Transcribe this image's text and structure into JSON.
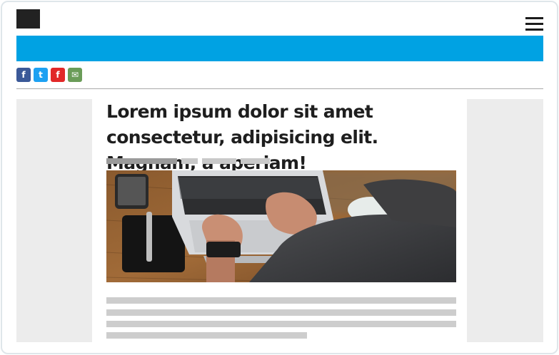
{
  "header": {
    "logo": "logo",
    "menu_icon": "hamburger-menu-icon"
  },
  "banner": {
    "color": "#00a2e3"
  },
  "share": {
    "items": [
      {
        "name": "facebook-share-icon",
        "glyph": "f",
        "color": "#3b5998"
      },
      {
        "name": "twitter-share-icon",
        "glyph": "t",
        "color": "#1da1f2"
      },
      {
        "name": "flipboard-share-icon",
        "glyph": "f",
        "color": "#e12828"
      },
      {
        "name": "email-share-icon",
        "glyph": "✉",
        "color": "#6a9c58"
      }
    ]
  },
  "article": {
    "title": "Lorem ipsum dolor sit amet consectetur, adipisicing elit. Magnam, a aperiam!",
    "image": "laptop-typing-photo"
  }
}
